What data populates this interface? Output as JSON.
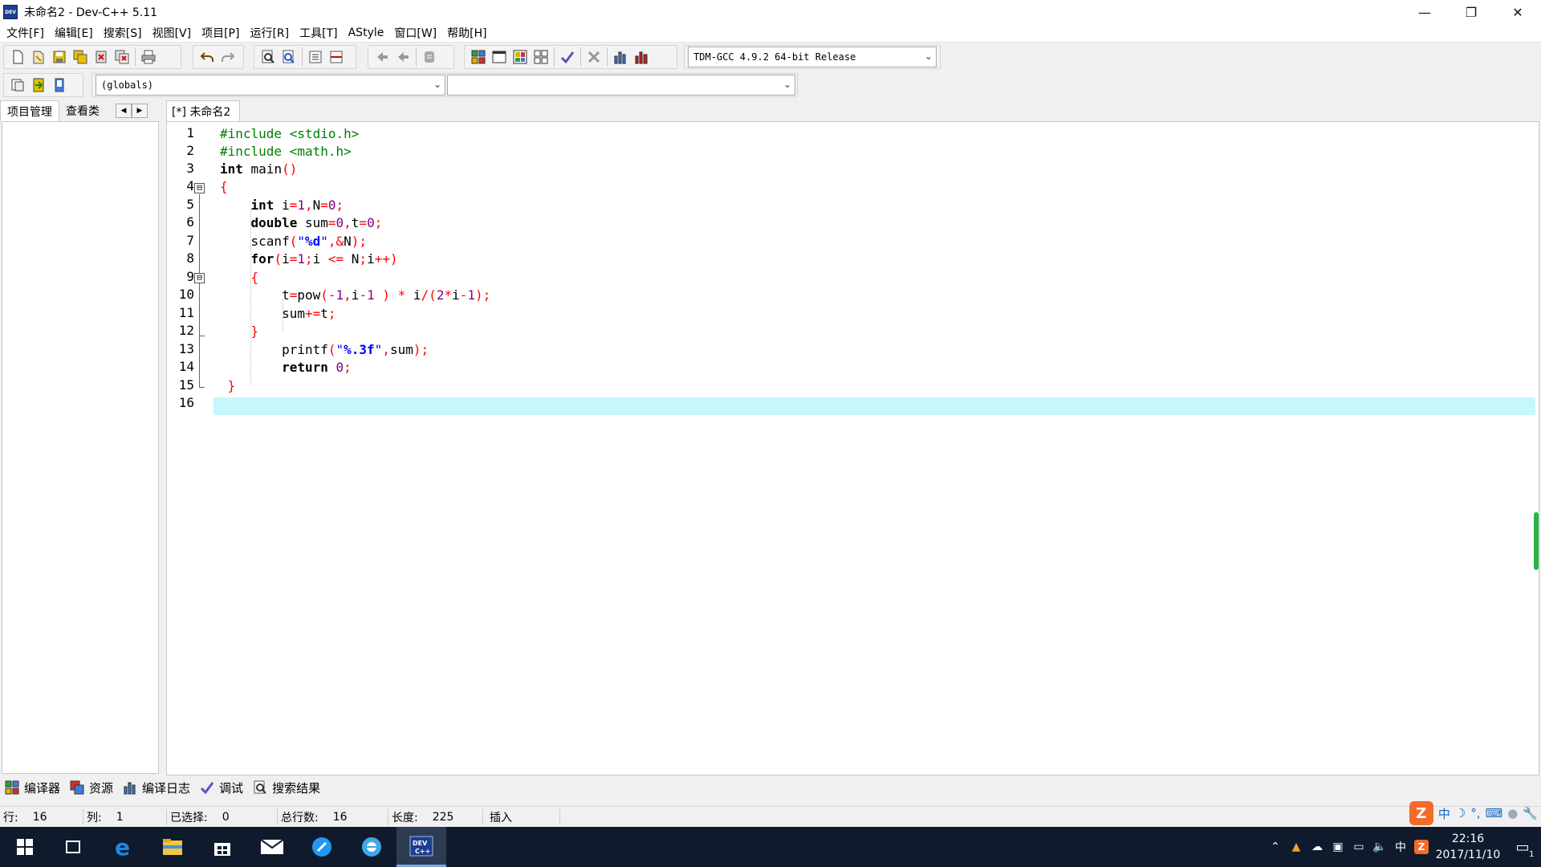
{
  "window": {
    "title": "未命名2 - Dev-C++ 5.11",
    "icon_text": "DEV",
    "controls": [
      "minimize-icon",
      "restore-icon",
      "close-icon"
    ]
  },
  "menu": [
    "文件[F]",
    "编辑[E]",
    "搜索[S]",
    "视图[V]",
    "项目[P]",
    "运行[R]",
    "工具[T]",
    "AStyle",
    "窗口[W]",
    "帮助[H]"
  ],
  "toolbar": {
    "compiler_select": "TDM-GCC 4.9.2 64-bit Release",
    "scope_select": "(globals)",
    "member_select": ""
  },
  "left_panel": {
    "tabs": [
      "项目管理",
      "查看类"
    ],
    "nav": [
      "◀",
      "▶"
    ]
  },
  "editor": {
    "tab_label": "[*] 未命名2",
    "line_numbers": [
      "1",
      "2",
      "3",
      "4",
      "5",
      "6",
      "7",
      "8",
      "9",
      "10",
      "11",
      "12",
      "13",
      "14",
      "15",
      "16"
    ],
    "fold_markers": [
      "⊟",
      "⊟"
    ],
    "code_lines": [
      "#include <stdio.h>",
      "#include <math.h>",
      "int main()",
      "{",
      "    int i=1,N=0;",
      "    double sum=0,t=0;",
      "    scanf(\"%d\",&N);",
      "    for(i=1;i <= N;i++)",
      "    {",
      "        t=pow(-1,i-1 ) * i/(2*i-1);",
      "        sum+=t;",
      "    }",
      "        printf(\"%.3f\",sum);",
      "        return 0;",
      " }",
      ""
    ],
    "current_line": 16
  },
  "bottom_tabs": [
    "编译器",
    "资源",
    "编译日志",
    "调试",
    "搜索结果"
  ],
  "status": {
    "row_label": "行:",
    "row_value": "16",
    "col_label": "列:",
    "col_value": "1",
    "sel_label": "已选择:",
    "sel_value": "0",
    "total_label": "总行数:",
    "total_value": "16",
    "len_label": "长度:",
    "len_value": "225",
    "mode": "插入"
  },
  "ime": {
    "logo": "Z",
    "lang": "中",
    "icons": [
      "moon-icon",
      "punctuation-icon",
      "keyboard-icon",
      "user-icon",
      "wrench-icon"
    ]
  },
  "taskbar": {
    "apps": [
      "windows-start-icon",
      "task-view-icon",
      "edge-icon",
      "file-explorer-icon",
      "store-icon",
      "mail-icon",
      "app-icon",
      "browser-icon",
      "devcpp-icon"
    ],
    "tray_lang": "中",
    "time": "22:16",
    "date": "2017/11/10",
    "notification_count": "1"
  },
  "colors": {
    "current_line": "#c6f7fb",
    "keyword": "#000000",
    "preprocessor": "#008000",
    "symbol": "#ff0000",
    "number": "#800080",
    "string": "#0000ff",
    "taskbar": "#0f1b2d"
  }
}
